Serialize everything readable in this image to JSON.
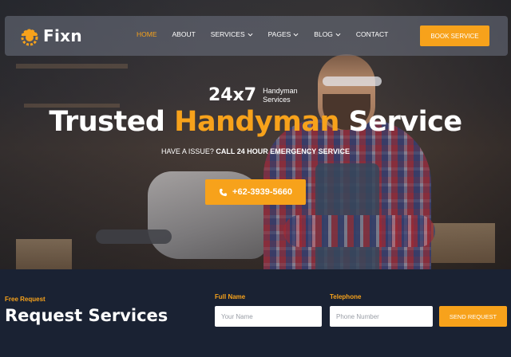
{
  "brand": {
    "name": "Fixn",
    "logo_icon": "hardhat-gear-icon",
    "accent": "#f7a21b"
  },
  "nav": {
    "items": [
      {
        "label": "HOME",
        "active": true,
        "dropdown": false
      },
      {
        "label": "ABOUT",
        "active": false,
        "dropdown": false
      },
      {
        "label": "SERVICES",
        "active": false,
        "dropdown": true
      },
      {
        "label": "PAGES",
        "active": false,
        "dropdown": true
      },
      {
        "label": "BLOG",
        "active": false,
        "dropdown": true
      },
      {
        "label": "CONTACT",
        "active": false,
        "dropdown": false
      }
    ],
    "cta": "BOOK SERVICE"
  },
  "hero": {
    "badge_big": "24x7",
    "badge_line1": "Handyman",
    "badge_line2": "Services",
    "title_part1": "Trusted ",
    "title_highlight": "Handyman",
    "title_part2": " Service",
    "sub_prefix": "HAVE A ISSUE? ",
    "sub_bold": "CALL 24 HOUR EMERGENCY SERVICE",
    "phone": "+62-3939-5660",
    "phone_icon": "phone-icon"
  },
  "request": {
    "kicker": "Free Request",
    "title": "Request Services",
    "name_label": "Full Name",
    "name_placeholder": "Your Name",
    "phone_label": "Telephone",
    "phone_placeholder": "Phone Number",
    "submit": "SEND REQUEST"
  }
}
